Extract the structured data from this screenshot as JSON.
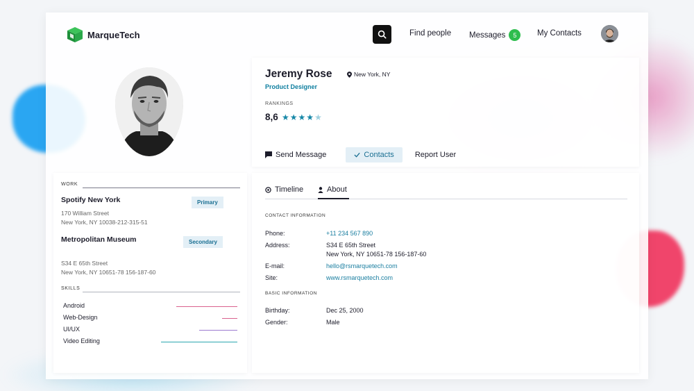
{
  "header": {
    "brand": "MarqueTech",
    "nav": {
      "find_people": "Find people",
      "messages": "Messages",
      "messages_count": "5",
      "my_contacts": "My Contacts"
    }
  },
  "profile": {
    "name": "Jeremy Rose",
    "location": "New York, NY",
    "role": "Product Designer",
    "rankings_label": "RANKINGS",
    "ranking_value": "8,6",
    "rating_stars_filled": 4,
    "rating_stars_total": 5,
    "actions": {
      "send_message": "Send Message",
      "contacts": "Contacts",
      "report_user": "Report User"
    }
  },
  "work": {
    "label": "WORK",
    "jobs": [
      {
        "title": "Spotify New York",
        "tag": "Primary",
        "address_line1": "170 William Street",
        "address_line2": "New York, NY 10038-212-315-51"
      },
      {
        "title": "Metropolitan Museum",
        "tag": "Secondary",
        "address_line1": "S34 E 65th Street",
        "address_line2": "New York, NY 10651-78 156-187-60"
      }
    ],
    "skills_label": "SKILLS",
    "skills": [
      {
        "name": "Android",
        "color": "#d9608e",
        "level": 0.8
      },
      {
        "name": "Web-Design",
        "color": "#d9608e",
        "level": 0.2
      },
      {
        "name": "UI/UX",
        "color": "#9b7ad0",
        "level": 0.5
      },
      {
        "name": "Video Editing",
        "color": "#2ba6b0",
        "level": 1.0
      }
    ]
  },
  "about": {
    "tabs": {
      "timeline": "Timeline",
      "about": "About"
    },
    "contact_label": "CONTACT INFORMATION",
    "contact": {
      "phone_key": "Phone:",
      "phone": "+11 234 567 890",
      "address_key": "Address:",
      "address_line1": "S34 E 65th Street",
      "address_line2": "New York, NY 10651-78 156-187-60",
      "email_key": "E-mail:",
      "email": "hello@rsmarquetech.com",
      "site_key": "Site:",
      "site": "www.rsmarquetech.com"
    },
    "basic_label": "BASIC INFORMATION",
    "basic": {
      "birthday_key": "Birthday:",
      "birthday": "Dec 25, 2000",
      "gender_key": "Gender:",
      "gender": "Male"
    }
  },
  "colors": {
    "accent": "#1a7ea0",
    "badge_green": "#2ebd4e",
    "blob_blue": "#2aa6f2",
    "blob_red": "#f0456b"
  }
}
